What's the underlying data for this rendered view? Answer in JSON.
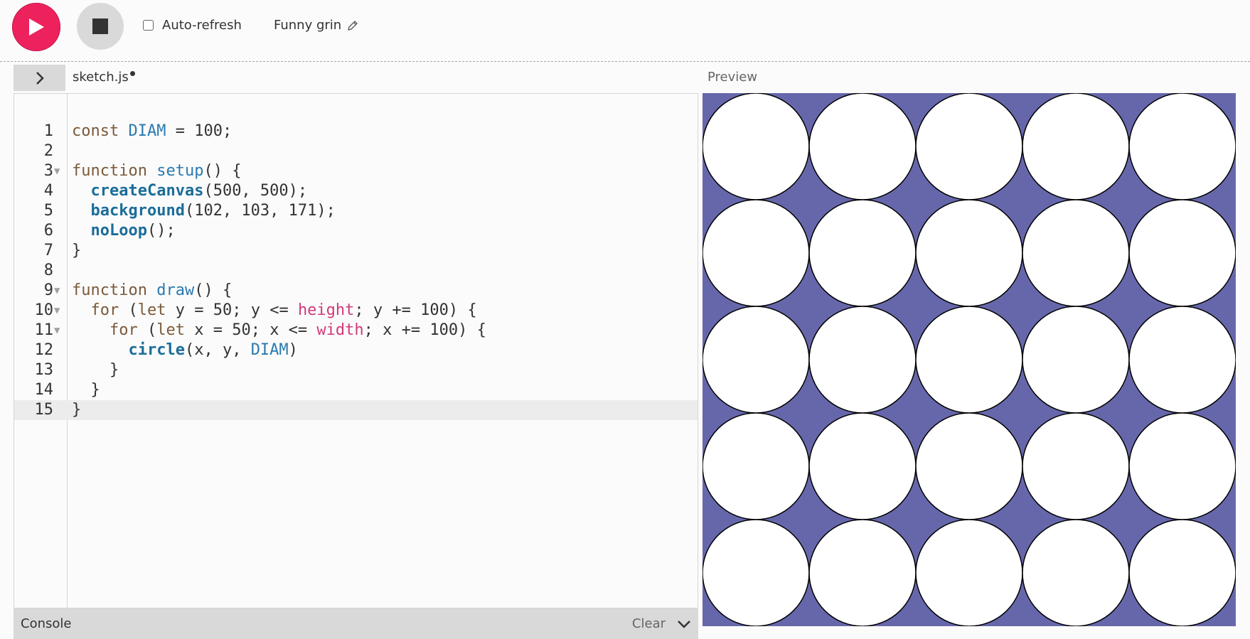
{
  "toolbar": {
    "play_icon": "play-icon",
    "stop_icon": "stop-icon",
    "autorefresh_label": "Auto-refresh",
    "autorefresh_checked": false,
    "sketch_name": "Funny grin",
    "edit_icon": "pencil-icon"
  },
  "editor": {
    "file_name": "sketch.js",
    "unsaved": true,
    "preview_label": "Preview",
    "active_line": 15,
    "lines": [
      "const DIAM = 100;",
      "",
      "function setup() {",
      "  createCanvas(500, 500);",
      "  background(102, 103, 171);",
      "  noLoop();",
      "}",
      "",
      "function draw() {",
      "  for (let y = 50; y <= height; y += 100) {",
      "    for (let x = 50; x <= width; x += 100) {",
      "      circle(x, y, DIAM)",
      "    }",
      "  }",
      "}"
    ],
    "folded_lines": [
      3,
      9,
      10,
      11
    ]
  },
  "console": {
    "title": "Console",
    "clear_label": "Clear",
    "collapse_icon": "chevron-down-icon"
  },
  "canvas": {
    "background": "#6667ab",
    "circle_fill": "#ffffff",
    "circle_stroke": "#000000",
    "size": [
      500,
      500
    ],
    "diameter": 100,
    "start": 50,
    "step": 100
  }
}
